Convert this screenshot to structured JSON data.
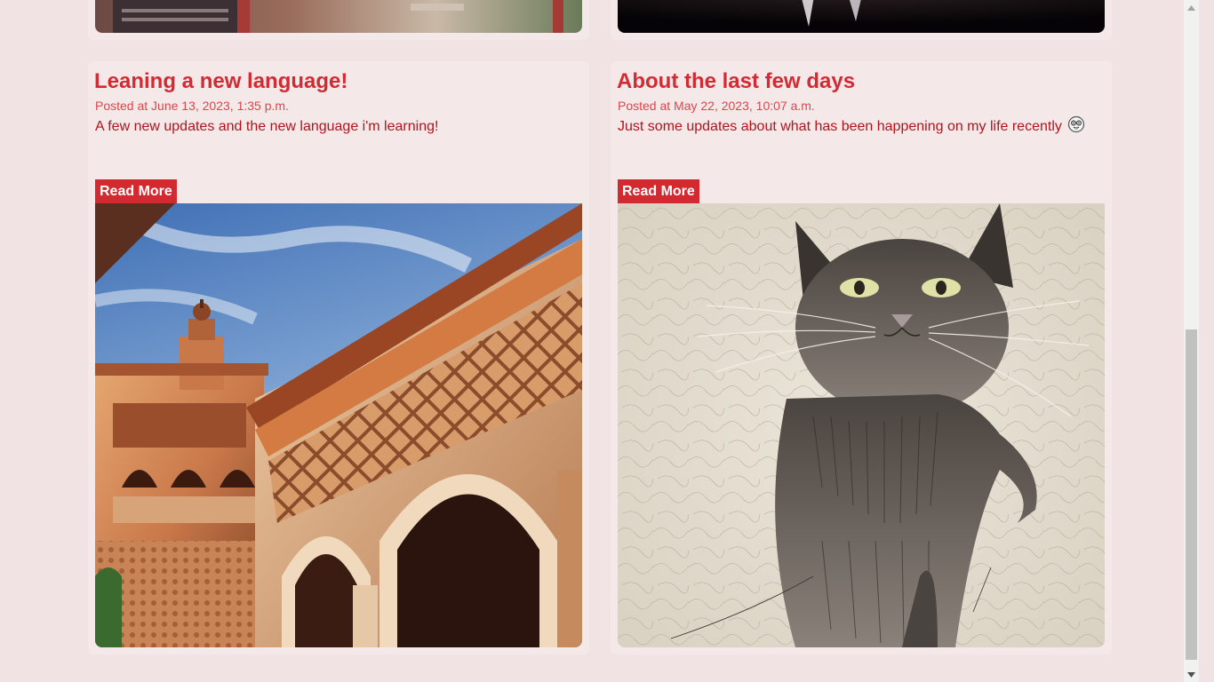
{
  "posts": [
    {
      "title": "Leaning a new language!",
      "date": "Posted at June 13, 2023, 1:35 p.m.",
      "summary": "A few new updates and the new language i'm learning!",
      "read_more": "Read More",
      "image": "moorish-palace-arches"
    },
    {
      "title": "About the last few days",
      "date": "Posted at May 22, 2023, 10:07 a.m.",
      "summary": "Just some updates about what has been happening on my life recently",
      "summary_icon": "nerd-face-emoji-icon",
      "read_more": "Read More",
      "image": "sketched-black-cat"
    }
  ],
  "colors": {
    "background": "#f1e2e3",
    "card": "#f4e8e9",
    "title": "#d22b33",
    "button": "#d12a31",
    "summary": "#b2141b"
  }
}
